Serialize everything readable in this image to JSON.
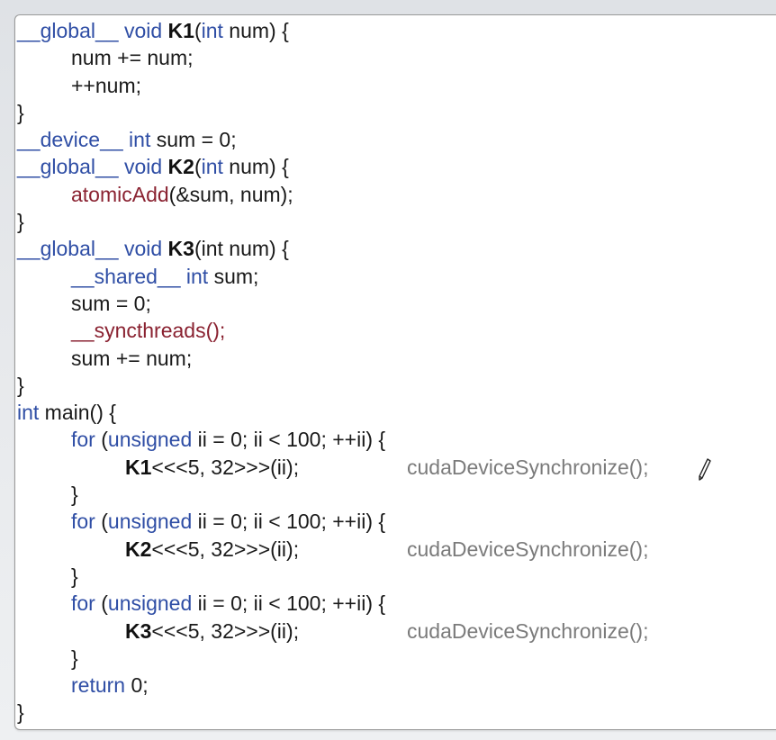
{
  "code": {
    "k1_def": {
      "qualifier": "__global__",
      "ret_type": "void",
      "name": "K1",
      "open": "(",
      "param_type": "int",
      "rest": " num) {"
    },
    "k1_body": [
      "num += num;",
      "++num;"
    ],
    "close_brace": "}",
    "device_decl": {
      "qualifier": "__device__",
      "type": "int",
      "rest": " sum = 0;"
    },
    "k2_def": {
      "qualifier": "__global__",
      "ret_type": "void",
      "name": "K2",
      "open": "(",
      "param_type": "int",
      "rest": " num) {"
    },
    "k2_body": {
      "call": "atomicAdd",
      "args": "(&sum, num);"
    },
    "k3_def": {
      "qualifier": "__global__",
      "ret_type": "void",
      "name": "K3",
      "rest": "(int num) {"
    },
    "k3_body": {
      "shared_qualifier": "__shared__",
      "shared_type": "int",
      "shared_rest": " sum;",
      "assign": "sum = 0;",
      "sync_call": "__syncthreads();",
      "accumulate": "sum += num;"
    },
    "main_def": {
      "type": "int",
      "rest": " main() {"
    },
    "loops": [
      {
        "for_kw": "for",
        "open": " (",
        "unsigned_kw": "unsigned",
        "header_rest": " ii = 0; ii < 100; ++ii) {",
        "kernel": "K1",
        "launch": "<<<5, 32>>>(ii);",
        "sync": "cudaDeviceSynchronize();"
      },
      {
        "for_kw": "for",
        "open": " (",
        "unsigned_kw": "unsigned",
        "header_rest": " ii = 0; ii < 100; ++ii) {",
        "kernel": "K2",
        "launch": "<<<5, 32>>>(ii);",
        "sync": "cudaDeviceSynchronize();"
      },
      {
        "for_kw": "for",
        "open": " (",
        "unsigned_kw": "unsigned",
        "header_rest": " ii = 0; ii < 100; ++ii) {",
        "kernel": "K3",
        "launch": "<<<5, 32>>>(ii);",
        "sync": "cudaDeviceSynchronize();"
      }
    ],
    "return_kw": "return",
    "return_rest": " 0;"
  },
  "colors": {
    "keyword": "#2f4ea5",
    "function_call": "#8a2231",
    "dimmed_call": "#7b7b7b",
    "text": "#1a1a1a"
  },
  "icons": {
    "cursor": "pencil-icon"
  }
}
